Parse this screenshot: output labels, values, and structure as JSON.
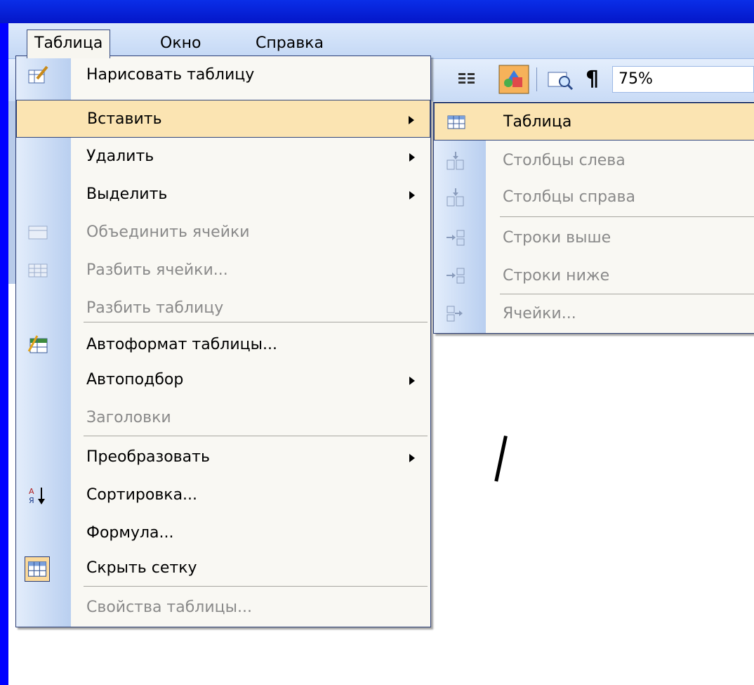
{
  "menubar": {
    "items": [
      {
        "label": "Таблица"
      },
      {
        "label": "Окно"
      },
      {
        "label": "Справка"
      }
    ]
  },
  "toolbar": {
    "zoom": "75%",
    "pilcrow": "¶"
  },
  "main_menu": {
    "items": [
      {
        "label": "Нарисовать таблицу"
      },
      {
        "label": "Вставить"
      },
      {
        "label": "Удалить"
      },
      {
        "label": "Выделить"
      },
      {
        "label": "Объединить ячейки"
      },
      {
        "label": "Разбить ячейки..."
      },
      {
        "label": "Разбить таблицу"
      },
      {
        "label": "Автоформат таблицы..."
      },
      {
        "label": "Автоподбор"
      },
      {
        "label": "Заголовки"
      },
      {
        "label": "Преобразовать"
      },
      {
        "label": "Сортировка..."
      },
      {
        "label": "Формула..."
      },
      {
        "label": "Скрыть сетку"
      },
      {
        "label": "Свойства таблицы..."
      }
    ]
  },
  "sub_menu": {
    "items": [
      {
        "label": "Таблица"
      },
      {
        "label": "Столбцы слева"
      },
      {
        "label": "Столбцы справа"
      },
      {
        "label": "Строки выше"
      },
      {
        "label": "Строки ниже"
      },
      {
        "label": "Ячейки..."
      }
    ]
  },
  "colors": {
    "background": "#0000ff",
    "menu_bg": "#f9f8f3",
    "highlight": "#fbe4b2",
    "disabled_text": "#8a8a8a"
  }
}
